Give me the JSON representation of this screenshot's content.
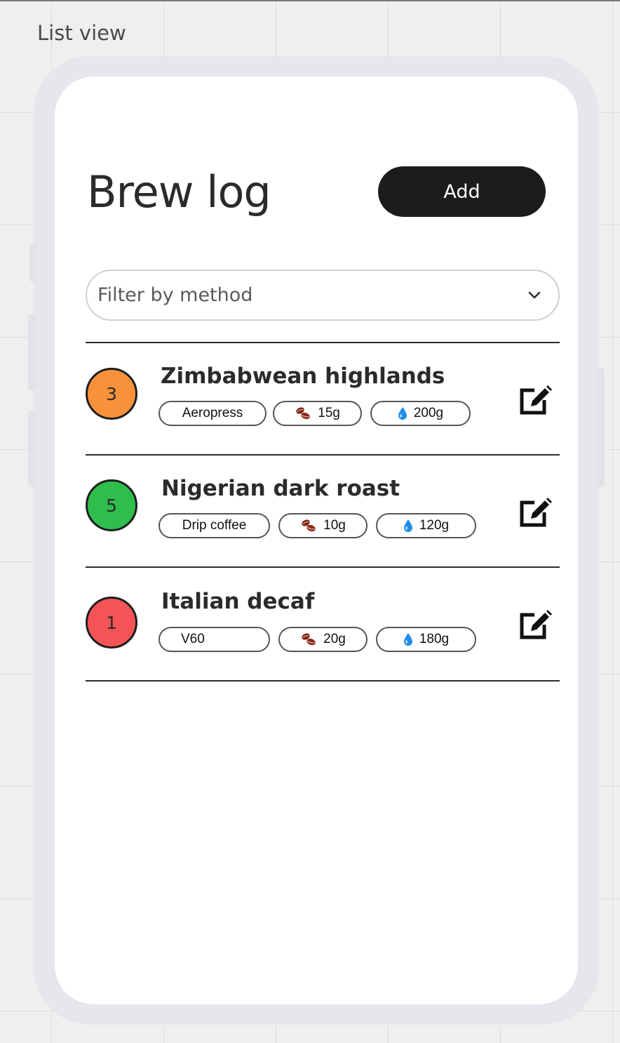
{
  "canvas": {
    "frame_label": "List view"
  },
  "header": {
    "title": "Brew log",
    "add_label": "Add"
  },
  "filter": {
    "placeholder": "Filter by method"
  },
  "brews": [
    {
      "name": "Zimbabwean highlands",
      "rating": "3",
      "rating_color": "#f7923a",
      "method": "Aeropress",
      "coffee": "15g",
      "water": "200g"
    },
    {
      "name": "Nigerian dark roast",
      "rating": "5",
      "rating_color": "#2fbe4b",
      "method": "Drip coffee",
      "coffee": "10g",
      "water": "120g"
    },
    {
      "name": "Italian decaf",
      "rating": "1",
      "rating_color": "#f45456",
      "method": "V60",
      "coffee": "20g",
      "water": "180g"
    }
  ],
  "icons": {
    "coffee": "coffee-bean-icon",
    "water": "water-drop-icon",
    "edit": "edit-icon",
    "filter": "chevron-down-icon"
  }
}
